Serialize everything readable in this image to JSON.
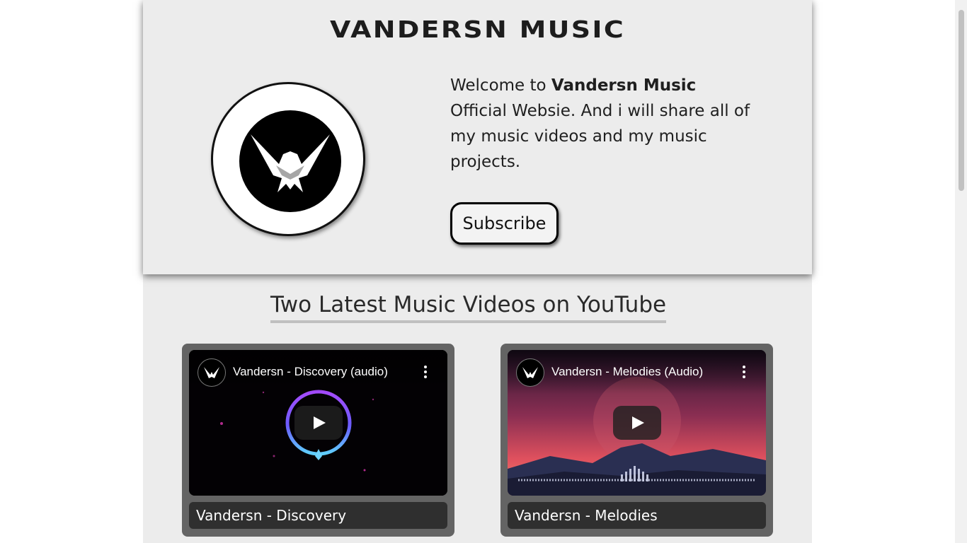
{
  "brand": {
    "name": "VANDERSN MUSIC"
  },
  "intro": {
    "welcome_prefix": "Welcome to ",
    "welcome_name": "Vandersn Music",
    "welcome_rest": "Official Websie. And i will share all of my music videos and my music projects.",
    "subscribe_label": "Subscribe"
  },
  "latest": {
    "heading": "Two Latest Music Videos on YouTube",
    "videos": [
      {
        "embed_title": "Vandersn - Discovery (audio)",
        "caption": "Vandersn - Discovery"
      },
      {
        "embed_title": "Vandersn - Melodies (Audio)",
        "caption": "Vandersn - Melodies"
      }
    ]
  },
  "icons": [
    "eagle-logo-icon",
    "channel-avatar-icon",
    "more-options-icon",
    "play-icon"
  ],
  "colors": {
    "page_bg": "#ececec",
    "card_bg": "#646464",
    "caption_bg": "#2f2f2f",
    "text": "#1f1f1f"
  }
}
